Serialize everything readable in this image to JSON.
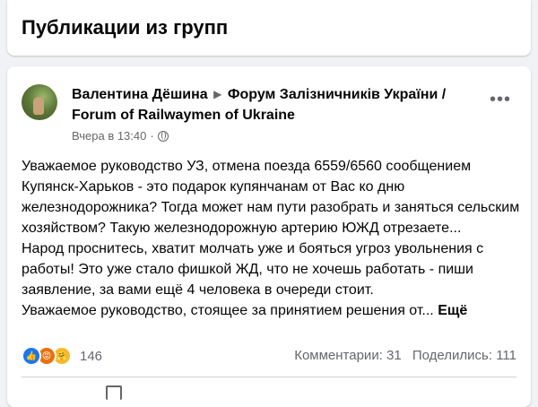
{
  "header": {
    "title": "Публикации из групп"
  },
  "post": {
    "author": "Валентина Дёшина",
    "group": "Форум Залізничників України / Forum of Railwaymen of Ukraine",
    "time": "Вчера в 13:40",
    "separator": "·",
    "more_icon": "•••",
    "paragraphs": [
      "Уважаемое руководство УЗ, отмена поезда 6559/6560 сообщением Купянск-Харьков - это подарок купянчанам от Вас ко дню железнодорожника? Тогда может нам пути разобрать и заняться сельским хозяйством? Такую железнодорожную артерию ЮЖД отрезаете...",
      "Народ проснитесь, хватит молчать уже и бояться угроз увольнения с работы! Это уже стало фишкой ЖД, что не хочешь работать - пиши заявление, за вами ещё 4 человека в очереди стоит."
    ],
    "last_line": "Уважаемое руководство, стоящее за принятием решения от...",
    "see_more": "Ещё",
    "reaction_count": "146",
    "comments": "Комментарии: 31",
    "shares": "Поделились: 111",
    "colors": {
      "like": "#1877f2",
      "angry": "#e9710f",
      "care": "#f7b928",
      "secondary_text": "#65676b"
    }
  }
}
